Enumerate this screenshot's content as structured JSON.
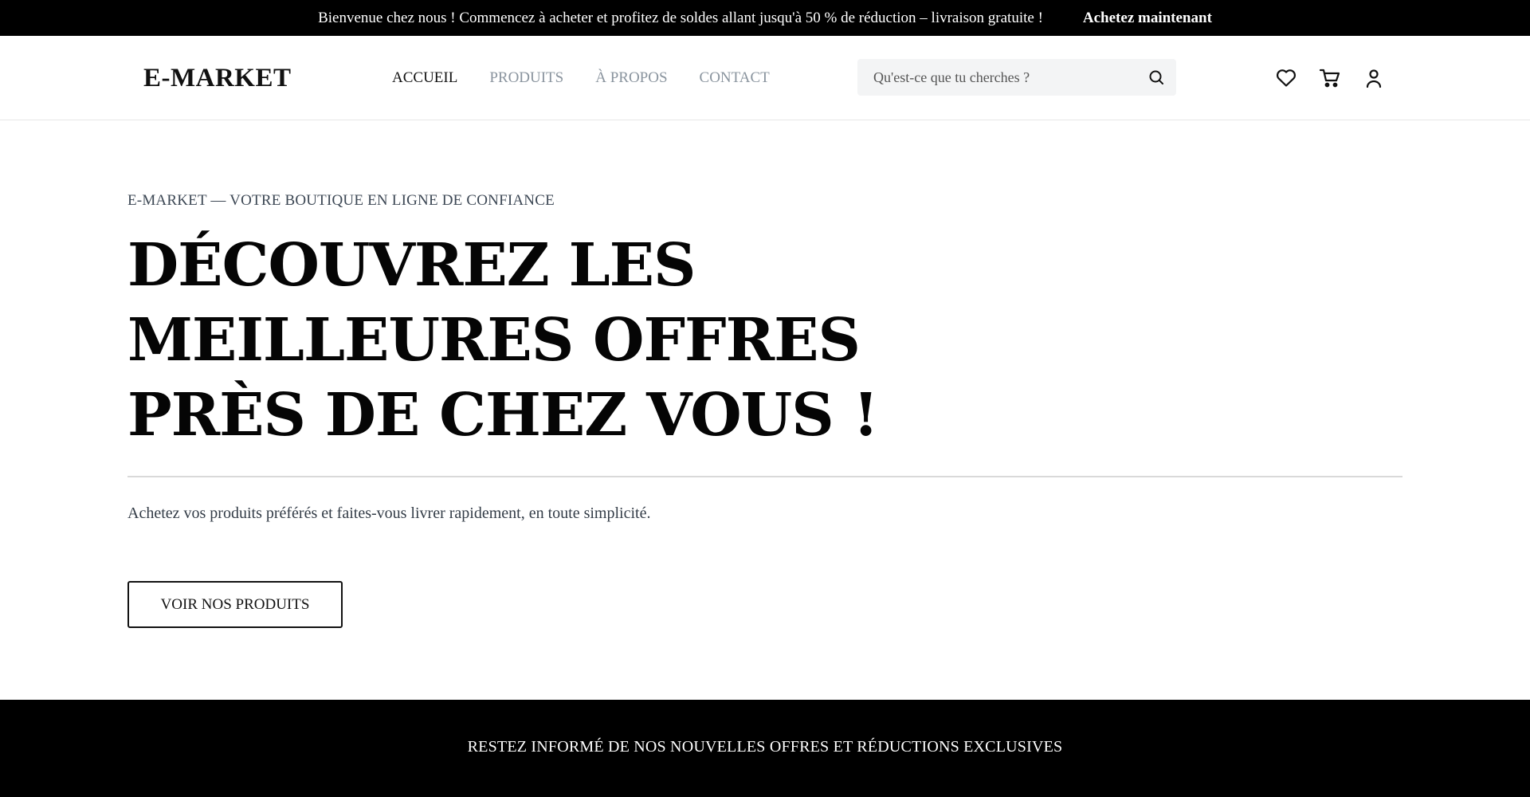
{
  "announcement": {
    "text": "Bienvenue chez nous ! Commencez à acheter et profitez de soldes allant jusqu'à 50 % de réduction – livraison gratuite !",
    "cta": "Achetez maintenant"
  },
  "header": {
    "logo": "E-MARKET",
    "nav": [
      {
        "label": "ACCUEIL",
        "active": true
      },
      {
        "label": "PRODUITS",
        "active": false
      },
      {
        "label": "À PROPOS",
        "active": false
      },
      {
        "label": "CONTACT",
        "active": false
      }
    ],
    "search": {
      "placeholder": "Qu'est-ce que tu cherches ?",
      "icon": "search-icon"
    },
    "icons": [
      "heart-icon",
      "cart-icon",
      "user-icon"
    ]
  },
  "hero": {
    "eyebrow": "E-MARKET — VOTRE BOUTIQUE EN LIGNE DE CONFIANCE",
    "headline_lines": [
      "DÉCOUVREZ LES",
      "MEILLEURES OFFRES",
      "PRÈS DE CHEZ VOUS !"
    ],
    "description": "Achetez vos produits préférés et faites-vous livrer rapidement, en toute simplicité.",
    "button": "VOIR NOS PRODUITS"
  },
  "newsletter": {
    "title": "RESTEZ INFORMÉ DE NOS NOUVELLES OFFRES ET RÉDUCTIONS EXCLUSIVES"
  },
  "colors": {
    "background": "#ffffff",
    "bar": "#000000",
    "nav_inactive": "#8a949e",
    "search_bg": "#f3f4f5"
  }
}
